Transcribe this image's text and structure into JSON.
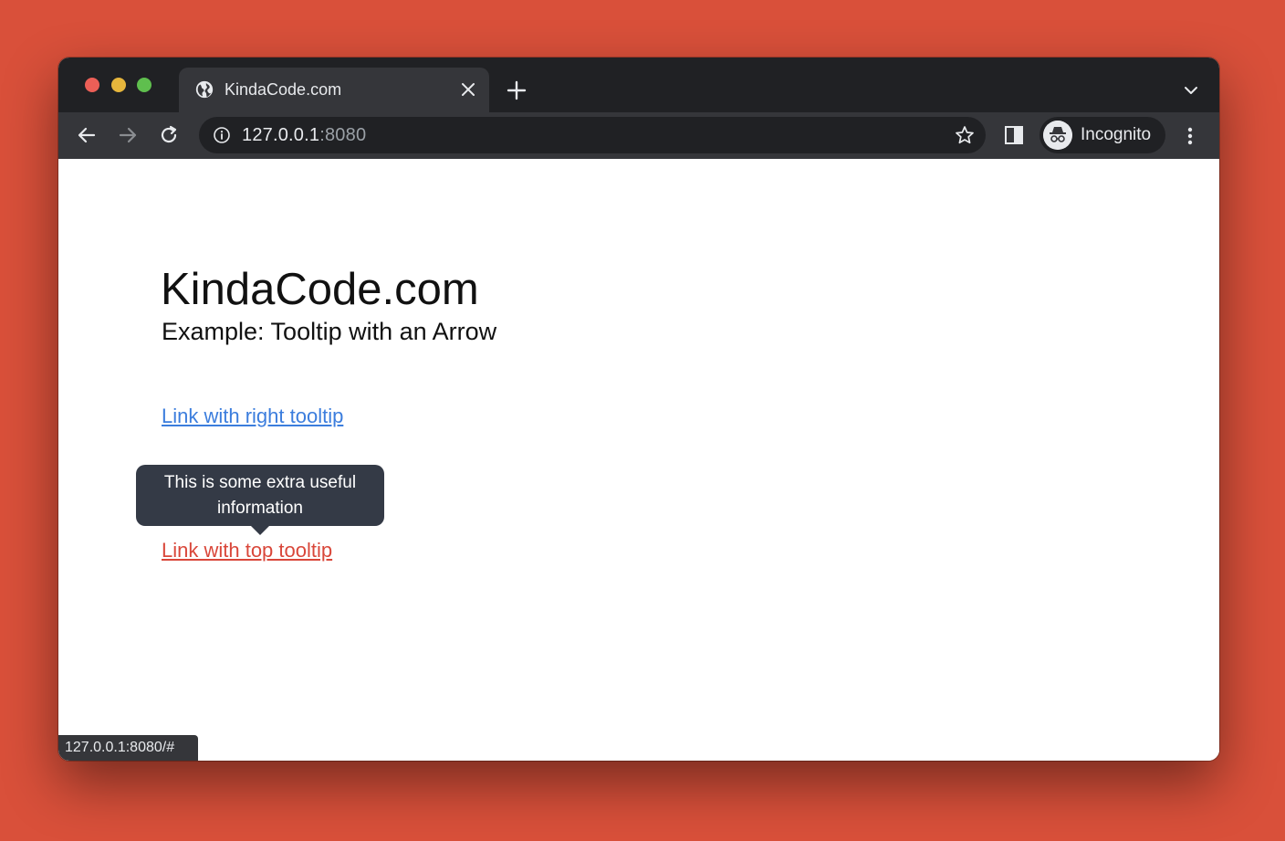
{
  "tab": {
    "title": "KindaCode.com",
    "favicon": "globe-icon"
  },
  "address_bar": {
    "host": "127.0.0.1",
    "port": ":8080"
  },
  "profile": {
    "label": "Incognito",
    "icon": "incognito-icon"
  },
  "page": {
    "title": "KindaCode.com",
    "subtitle": "Example: Tooltip with an Arrow",
    "link_right": "Link with right tooltip",
    "link_top": "Link with top tooltip",
    "tooltip_text": "This is some extra useful information"
  },
  "status_bar": {
    "url": "127.0.0.1:8080/#"
  },
  "colors": {
    "background": "#d9503a",
    "link_right": "#3b7ddd",
    "link_top": "#d9473a",
    "tooltip_bg": "#343a46",
    "chrome_dark": "#202124",
    "chrome_toolbar": "#35363a"
  }
}
